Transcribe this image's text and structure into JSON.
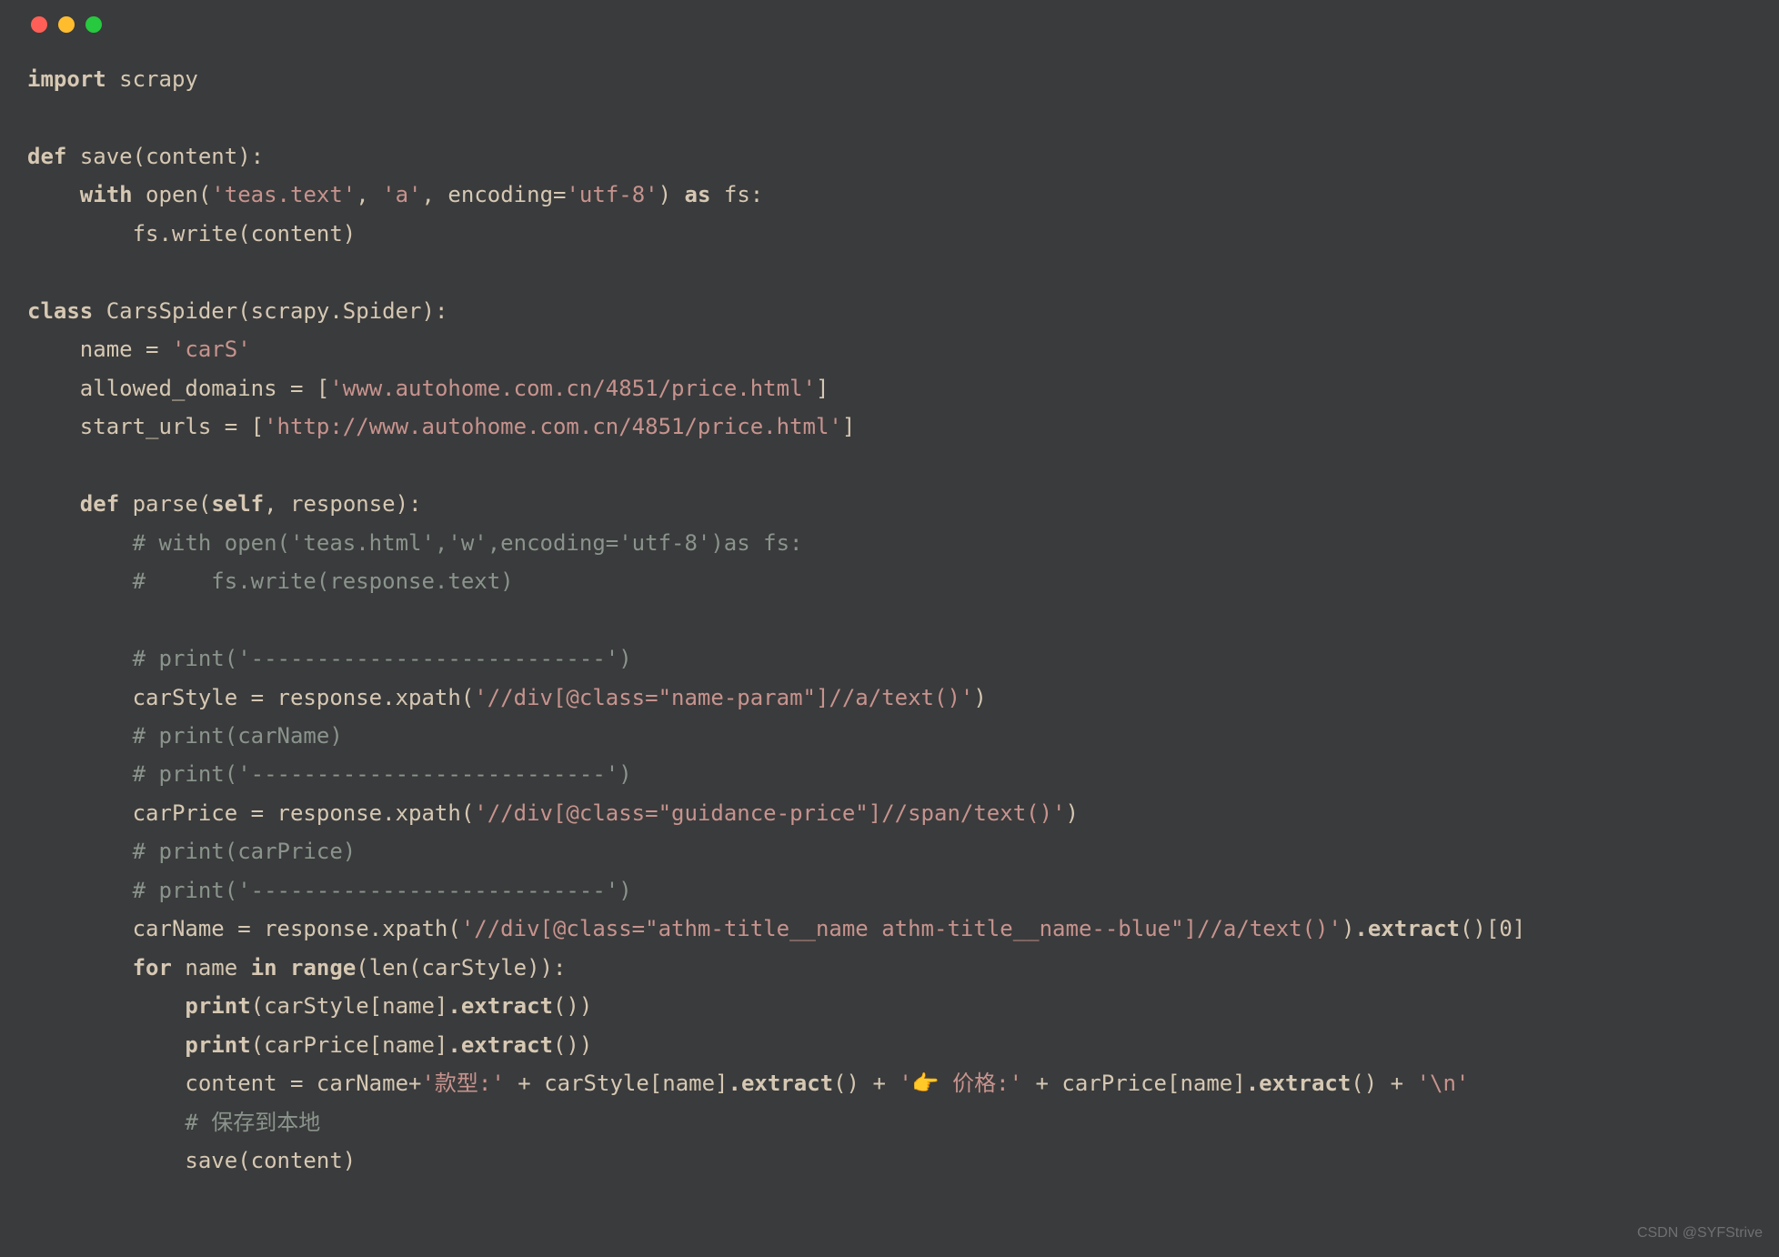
{
  "syntax": {
    "kw_import": "import",
    "kw_def": "def",
    "kw_class": "class",
    "kw_as": "as",
    "kw_for": "for",
    "kw_in": "in",
    "kw_with": "with"
  },
  "code": {
    "mod_scrapy": "scrapy",
    "fn_save": "save",
    "param_content": "content",
    "fn_open": "open",
    "str_teas_text": "'teas.text'",
    "str_mode_a": "'a'",
    "kw_encoding": "encoding",
    "str_utf8": "'utf-8'",
    "var_fs": "fs",
    "fs_write": "fs.write(content)",
    "class_name": "CarsSpider",
    "base_class": "scrapy.Spider",
    "attr_name": "name = ",
    "val_name": "'carS'",
    "attr_allowed": "allowed_domains = [",
    "val_allowed": "'www.autohome.com.cn/4851/price.html'",
    "attr_start": "start_urls = [",
    "val_start": "'http://www.autohome.com.cn/4851/price.html'",
    "fn_parse": "parse",
    "param_self": "self",
    "param_response": "response",
    "cmt1": "# with open('teas.html','w',encoding='utf-8')as fs:",
    "cmt2": "#     fs.write(response.text)",
    "cmt_dash": "# print('---------------------------')",
    "carStyle_lhs": "carStyle = response.xpath(",
    "carStyle_xp": "'//div[@class=\"name-param\"]//a/text()'",
    "cmt_printCarName": "# print(carName)",
    "carPrice_lhs": "carPrice = response.xpath(",
    "carPrice_xp": "'//div[@class=\"guidance-price\"]//span/text()'",
    "cmt_printCarPrice": "# print(carPrice)",
    "carName_lhs": "carName = response.xpath(",
    "carName_xp": "'//div[@class=\"athm-title__name athm-title__name--blue\"]//a/text()'",
    "extract0": "()[0]",
    "for_name": "name",
    "range_len": "(len(carStyle)):",
    "range": "range",
    "print": "print",
    "print_style": "(carStyle[name]",
    "print_price": "(carPrice[name]",
    "extract": ".extract",
    "paren_close": "())",
    "content_lhs": "content = carName+",
    "str_kuanxing": "'款型:'",
    "plus": " + ",
    "carStyle_idx": "carStyle[name]",
    "carPrice_idx": "carPrice[name]",
    "str_finger_price": "'👉 价格:'",
    "str_newline": "'\\n'",
    "cmt_save_local": "# 保存到本地",
    "save_call": "save(content)",
    "close_paren": ")",
    "close_bracket": "]",
    "open_paren": "(",
    "comma_sp": ", ",
    "eq": "=",
    "colon": ":",
    "dot_extract_open": "()"
  },
  "watermark": "CSDN @SYFStrive"
}
